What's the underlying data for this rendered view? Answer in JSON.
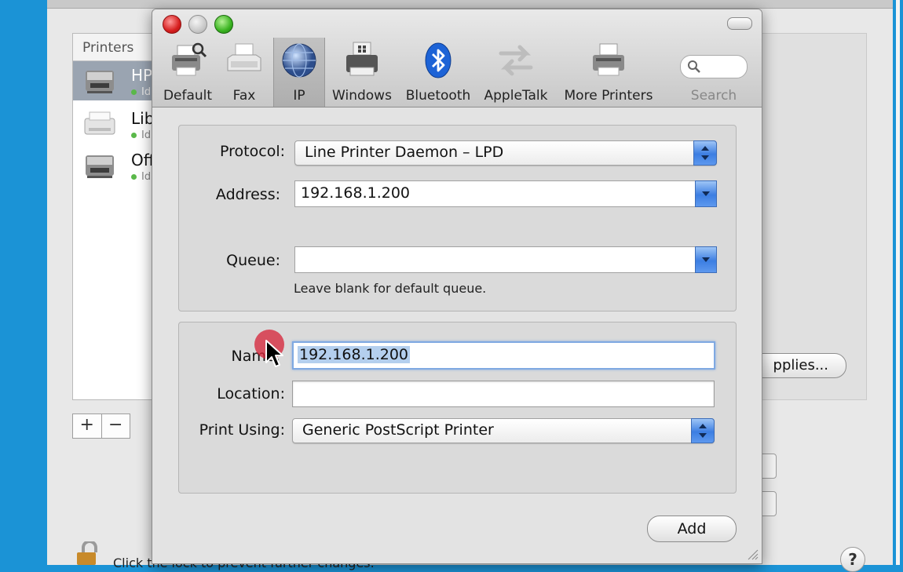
{
  "background_window": {
    "printers_header": "Printers",
    "printers": [
      {
        "name": "HP",
        "status": "Id",
        "selected": true
      },
      {
        "name": "Lib",
        "status": "Id",
        "selected": false
      },
      {
        "name": "Off",
        "status": "Id",
        "selected": false
      }
    ],
    "add_label": "+",
    "remove_label": "−",
    "supplies_label": "pplies...",
    "lock_text": "Click the lock to prevent further changes.",
    "help_label": "?"
  },
  "sheet": {
    "toolbar": [
      {
        "label": "Default",
        "icon": "printer-magnifier-icon"
      },
      {
        "label": "Fax",
        "icon": "fax-icon"
      },
      {
        "label": "IP",
        "icon": "globe-icon",
        "selected": true
      },
      {
        "label": "Windows",
        "icon": "windows-printer-icon"
      },
      {
        "label": "Bluetooth",
        "icon": "bluetooth-icon"
      },
      {
        "label": "AppleTalk",
        "icon": "appletalk-arrows-icon"
      },
      {
        "label": "More Printers",
        "icon": "printer-icon"
      }
    ],
    "search_label": "Search",
    "protocol": {
      "label": "Protocol:",
      "value": "Line Printer Daemon – LPD"
    },
    "address": {
      "label": "Address:",
      "value": "192.168.1.200"
    },
    "queue": {
      "label": "Queue:",
      "value": "",
      "hint": "Leave blank for default queue."
    },
    "name": {
      "label": "Name:",
      "value": "192.168.1.200"
    },
    "location": {
      "label": "Location:",
      "value": ""
    },
    "print_using": {
      "label": "Print Using:",
      "value": "Generic PostScript Printer"
    },
    "add_button": "Add"
  },
  "colors": {
    "desktop": "#1b93d6",
    "accent_blue": "#3c7ee2",
    "selection": "#b4cfee",
    "cursor_highlight": "#d6283c"
  }
}
